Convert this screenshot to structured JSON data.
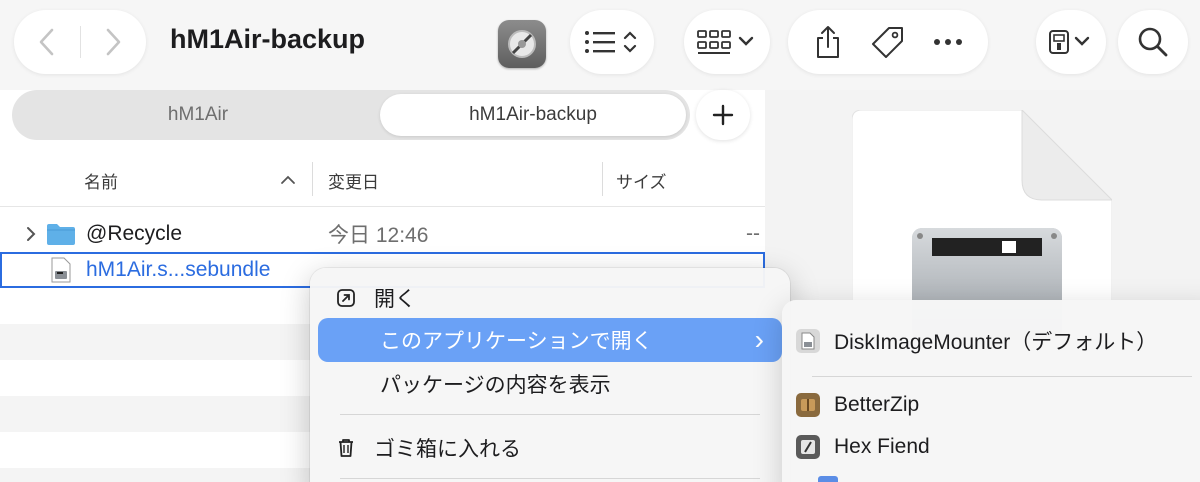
{
  "window": {
    "title": "hM1Air-backup"
  },
  "toolbar": {
    "icons": [
      "chevron-left-icon",
      "chevron-right-icon",
      "list-view-icon",
      "grid-view-icon",
      "share-icon",
      "tag-icon",
      "more-icon",
      "drive-icon",
      "search-icon"
    ]
  },
  "tabs": [
    {
      "label": "hM1Air",
      "active": false
    },
    {
      "label": "hM1Air-backup",
      "active": true
    }
  ],
  "columns": {
    "name": "名前",
    "modified": "変更日",
    "size": "サイズ"
  },
  "rows": [
    {
      "name": "@Recycle",
      "modified": "今日 12:46",
      "size": "--",
      "kind": "folder"
    },
    {
      "name": "hM1Air.s...sebundle",
      "kind": "sparsebundle",
      "selected": true
    }
  ],
  "context_menu": {
    "items": [
      {
        "label": "開く",
        "icon": "open-icon"
      },
      {
        "label": "このアプリケーションで開く",
        "icon": "",
        "highlighted": true,
        "submenu_arrow": "›"
      },
      {
        "label": "パッケージの内容を表示",
        "icon": ""
      },
      {
        "label": "ゴミ箱に入れる",
        "icon": "trash-icon"
      }
    ]
  },
  "open_with_submenu": {
    "items": [
      {
        "label": "DiskImageMounter（デフォルト）",
        "icon": "disk-image-mounter-icon"
      },
      {
        "label": "BetterZip",
        "icon": "betterzip-icon"
      },
      {
        "label": "Hex Fiend",
        "icon": "hex-fiend-icon"
      }
    ]
  },
  "colors": {
    "accent": "#2b6ce0",
    "menu_highlight": "#6aa1f6",
    "folder": "#5fb0e8"
  }
}
